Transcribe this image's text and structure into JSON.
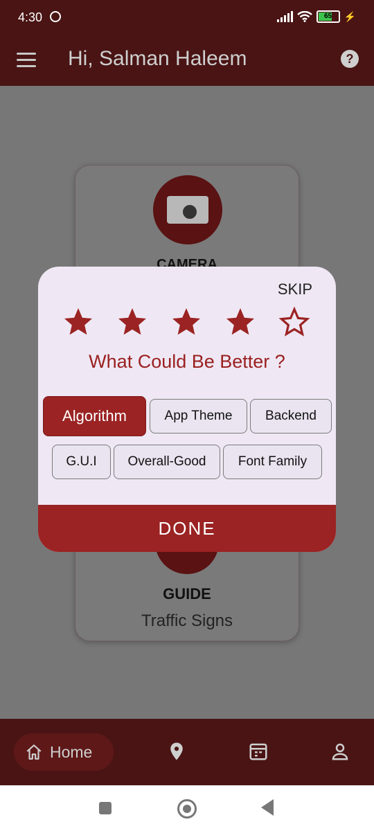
{
  "status_bar": {
    "time": "4:30",
    "battery": "65"
  },
  "app_bar": {
    "title": "Hi, Salman Haleem"
  },
  "background_card": {
    "camera_label": "CAMERA",
    "guide_label": "GUIDE",
    "guide_subtitle": "Traffic Signs"
  },
  "dialog": {
    "skip": "SKIP",
    "rating": 4,
    "max_rating": 5,
    "question": "What Could Be Better ?",
    "chips": [
      "Algorithm",
      "App Theme",
      "Backend",
      "G.U.I",
      "Overall-Good",
      "Font Family"
    ],
    "selected_chip": "Algorithm",
    "done": "DONE"
  },
  "bottom_nav": {
    "home_label": "Home"
  },
  "colors": {
    "accent": "#9b2323",
    "bar": "#4a1414"
  }
}
